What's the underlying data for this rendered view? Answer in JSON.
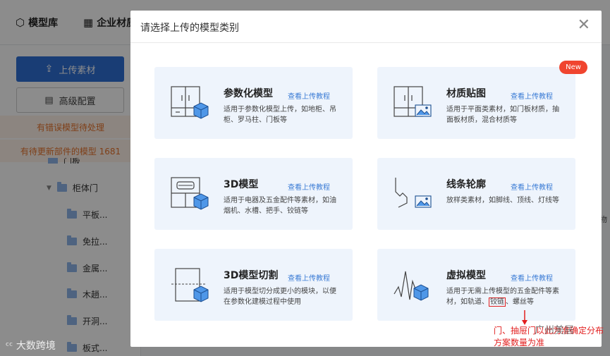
{
  "nav": {
    "model_library": "模型库",
    "enterprise_materials": "企业材质"
  },
  "sidebar": {
    "upload_button": "上传素材",
    "config_button": "高级配置",
    "warn_error": "有错误模型待处理",
    "warn_update": "有待更新部件的模型 1681",
    "tree": {
      "partial_item": "门板",
      "cabinet_door": "柜体门",
      "children": [
        "平板...",
        "免拉...",
        "金属...",
        "木趟...",
        "开洞...",
        "板式..."
      ]
    }
  },
  "right_hint": "物",
  "modal": {
    "title": "请选择上传的模型类别",
    "new_badge": "New",
    "cards": [
      {
        "title": "参数化模型",
        "link": "查看上传教程",
        "desc": "适用于参数化模型上传，如地柜、吊柜、罗马柱、门板等",
        "icon": "cabinet-cube-icon"
      },
      {
        "title": "材质贴图",
        "link": "查看上传教程",
        "desc": "适用于平面类素材，如门板材质，抽面板材质，混合材质等",
        "icon": "cabinet-image-icon"
      },
      {
        "title": "3D模型",
        "link": "查看上传教程",
        "desc": "适用于电器及五金配件等素材，如油烟机、水槽、把手、铰链等",
        "icon": "appliance-cube-icon"
      },
      {
        "title": "线条轮廓",
        "link": "查看上传教程",
        "desc": "放样类素材，如脚线、顶线、灯线等",
        "icon": "profile-line-icon"
      },
      {
        "title": "3D模型切割",
        "link": "查看上传教程",
        "desc": "适用于模型切分成更小的模块，以便在参数化建模过程中使用",
        "icon": "cut-cube-icon"
      },
      {
        "title": "虚拟模型",
        "link": "查看上传教程",
        "desc_before": "适用于无需上传模型的五金配件等素材，如轨道、",
        "desc_highlight": "铰链",
        "desc_after": "、螺丝等",
        "icon": "wave-cube-icon"
      }
    ]
  },
  "annotation": {
    "line1": "门、抽屉门以此为准确定分布",
    "line2": "方案数量为准"
  },
  "watermarks": {
    "left": "大数跨境",
    "right": "广州美居"
  }
}
